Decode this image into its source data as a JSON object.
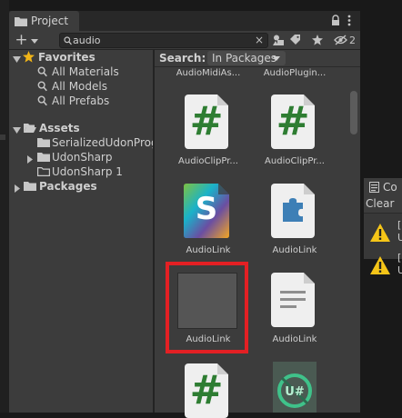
{
  "project_tab": {
    "label": "Project"
  },
  "toolbar": {
    "add_label": "+",
    "search": {
      "value": "audio",
      "clear": "×"
    },
    "hidden_count": "2"
  },
  "tree": {
    "favorites": {
      "label": "Favorites",
      "items": [
        "All Materials",
        "All Models",
        "All Prefabs"
      ]
    },
    "assets": {
      "label": "Assets",
      "items": [
        "SerializedUdonProg",
        "UdonSharp",
        "UdonSharp 1"
      ]
    },
    "packages": {
      "label": "Packages"
    }
  },
  "grid": {
    "search_label": "Search:",
    "scope": "In Packages",
    "top_row": [
      "AudioMidiAs...",
      "AudioPlugin..."
    ],
    "row1": [
      "AudioClipPr...",
      "AudioClipPr..."
    ],
    "row2": [
      "AudioLink",
      "AudioLink"
    ],
    "row3": [
      "AudioLink",
      "AudioLink"
    ],
    "hash_glyph": "#",
    "s_glyph": "S"
  },
  "console": {
    "tab_label": "Co",
    "clear_label": "Clear",
    "rows": [
      {
        "l1": "[",
        "l2": "U"
      },
      {
        "l1": "[",
        "l2": "U"
      }
    ]
  },
  "colors": {
    "highlight": "#e32024",
    "csharp_green": "#2e7d32",
    "star": "#f0b418",
    "warning": "#f5c518"
  }
}
